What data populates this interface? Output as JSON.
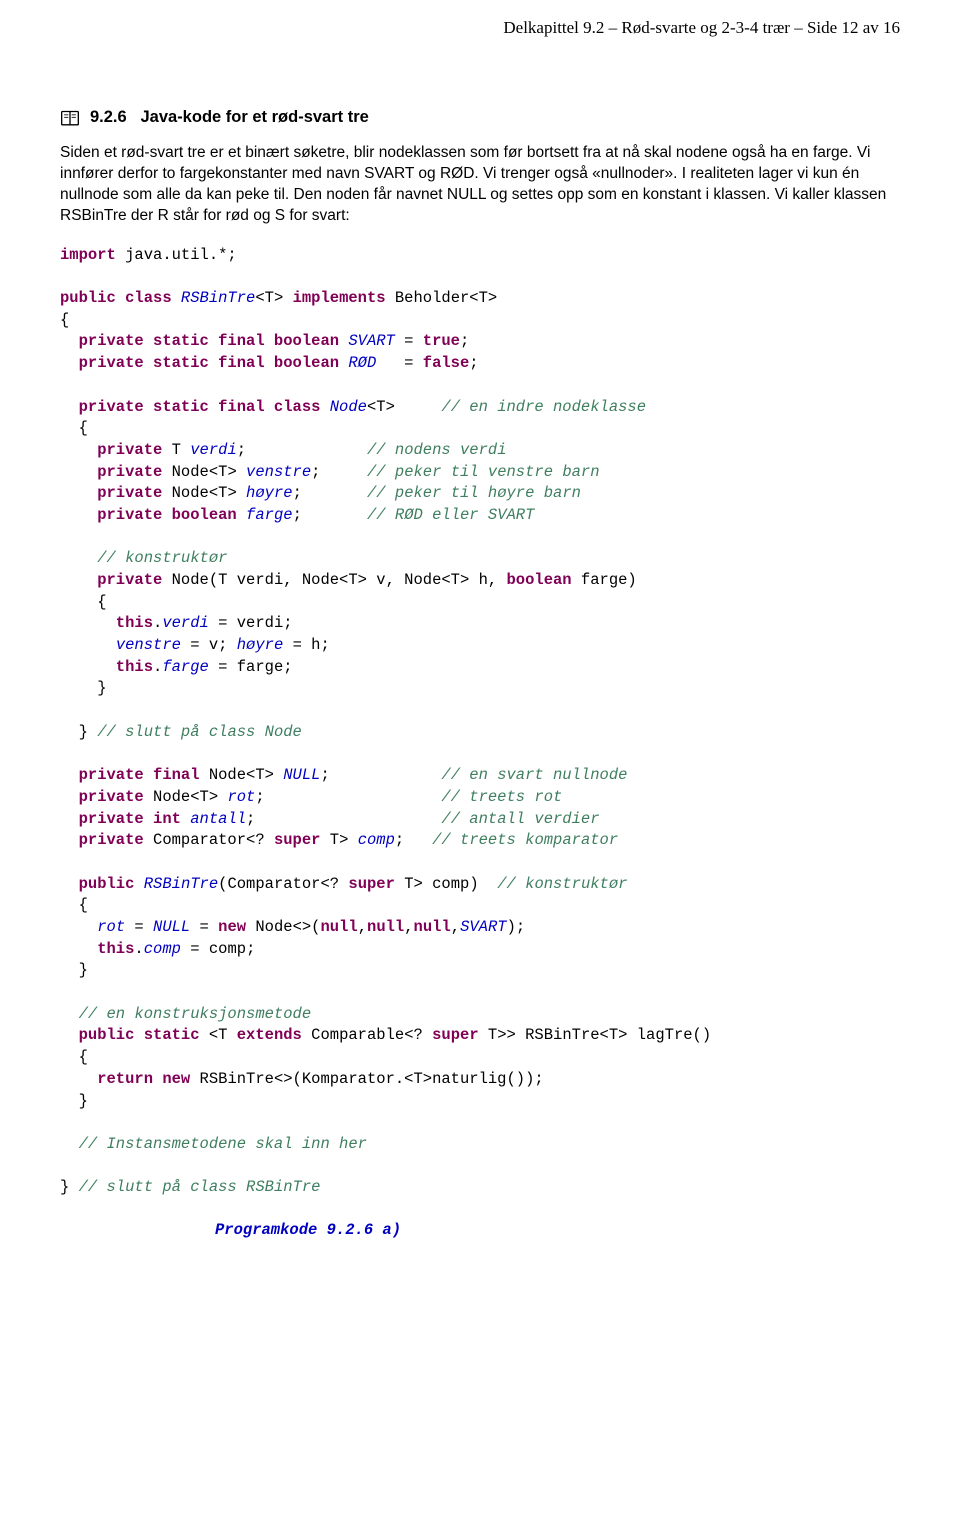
{
  "header": {
    "chapter": "Delkapittel 9.2",
    "sep1": "  –  ",
    "topic": "Rød-svarte og 2-3-4 trær",
    "sep2": "  –  ",
    "page": "Side 12 av 16"
  },
  "section": {
    "number": "9.2.6",
    "title": "Java-kode for et rød-svart tre"
  },
  "para1": "Siden et rød-svart tre er et binært søketre, blir nodeklassen som før bortsett fra at nå skal nodene også ha en farge. Vi innfører derfor to fargekonstanter med navn SVART og RØD. Vi trenger også «nullnoder». I realiteten lager vi kun én nullnode som alle da kan peke til. Den noden får navnet NULL og settes opp som en konstant i klassen. Vi kaller klassen RSBinTre der R står for rød og S for svart:",
  "code": {
    "l1a": "import",
    "l1b": " java.util.*;",
    "l2a": "public class",
    "l2b": " RSBinTre",
    "l2c": "<T> ",
    "l2d": "implements",
    "l2e": " Beholder<T>",
    "l3": "{",
    "l4a": "  private static final boolean",
    "l4b": " SVART",
    "l4c": " = ",
    "l4d": "true",
    "l4e": ";",
    "l5a": "  private static final boolean",
    "l5b": " RØD",
    "l5c": "   = ",
    "l5d": "false",
    "l5e": ";",
    "l6a": "  private static final class",
    "l6b": " Node",
    "l6c": "<T>     ",
    "l6d": "// en indre nodeklasse",
    "l7": "  {",
    "l8a": "    private",
    "l8b": " T ",
    "l8c": "verdi",
    "l8d": ";             ",
    "l8e": "// nodens verdi",
    "l9a": "    private",
    "l9b": " Node<T> ",
    "l9c": "venstre",
    "l9d": ";     ",
    "l9e": "// peker til venstre barn",
    "l10a": "    private",
    "l10b": " Node<T> ",
    "l10c": "høyre",
    "l10d": ";       ",
    "l10e": "// peker til høyre barn",
    "l11a": "    private boolean",
    "l11b": " ",
    "l11c": "farge",
    "l11d": ";       ",
    "l11e": "// RØD eller SVART",
    "l12a": "    // konstruktør",
    "l13a": "    private",
    "l13b": " Node(T verdi, Node<T> v, Node<T> h, ",
    "l13c": "boolean",
    "l13d": " farge)",
    "l14": "    {",
    "l15a": "      this",
    "l15b": ".",
    "l15c": "verdi",
    "l15d": " = verdi;",
    "l16a": "      ",
    "l16b": "venstre",
    "l16c": " = v; ",
    "l16d": "høyre",
    "l16e": " = h;",
    "l17a": "      this",
    "l17b": ".",
    "l17c": "farge",
    "l17d": " = farge;",
    "l18": "    }",
    "l19": "  } ",
    "l19b": "// slutt på class Node",
    "l20a": "  private final",
    "l20b": " Node<T> ",
    "l20c": "NULL",
    "l20d": ";            ",
    "l20e": "// en svart nullnode",
    "l21a": "  private",
    "l21b": " Node<T> ",
    "l21c": "rot",
    "l21d": ";                   ",
    "l21e": "// treets rot",
    "l22a": "  private int",
    "l22b": " ",
    "l22c": "antall",
    "l22d": ";                    ",
    "l22e": "// antall verdier",
    "l23a": "  private",
    "l23b": " Comparator<? ",
    "l23c": "super",
    "l23d": " T> ",
    "l23e": "comp",
    "l23f": ";   ",
    "l23g": "// treets komparator",
    "l24a": "  public",
    "l24b": " ",
    "l24c": "RSBinTre",
    "l24d": "(Comparator<? ",
    "l24e": "super",
    "l24f": " T> comp)  ",
    "l24g": "// konstruktør",
    "l25": "  {",
    "l26a": "    ",
    "l26b": "rot",
    "l26c": " = ",
    "l26d": "NULL",
    "l26e": " = ",
    "l26f": "new",
    "l26g": " Node<>(",
    "l26h": "null",
    "l26i": ",",
    "l26j": "null",
    "l26k": ",",
    "l26l": "null",
    "l26m": ",",
    "l26n": "SVART",
    "l26o": ");",
    "l27a": "    this",
    "l27b": ".",
    "l27c": "comp",
    "l27d": " = comp;",
    "l28": "  }",
    "l29a": "  // en konstruksjonsmetode",
    "l30a": "  public static",
    "l30b": " <T ",
    "l30c": "extends",
    "l30d": " Comparable<? ",
    "l30e": "super",
    "l30f": " T>> RSBinTre<T> lagTre()",
    "l31": "  {",
    "l32a": "    return new",
    "l32b": " RSBinTre<>(Komparator.<T>naturlig());",
    "l33": "  }",
    "l34a": "  // Instansmetodene skal inn her",
    "l35": "} ",
    "l35b": "// slutt på class RSBinTre"
  },
  "caption": "Programkode 9.2.6 a)"
}
